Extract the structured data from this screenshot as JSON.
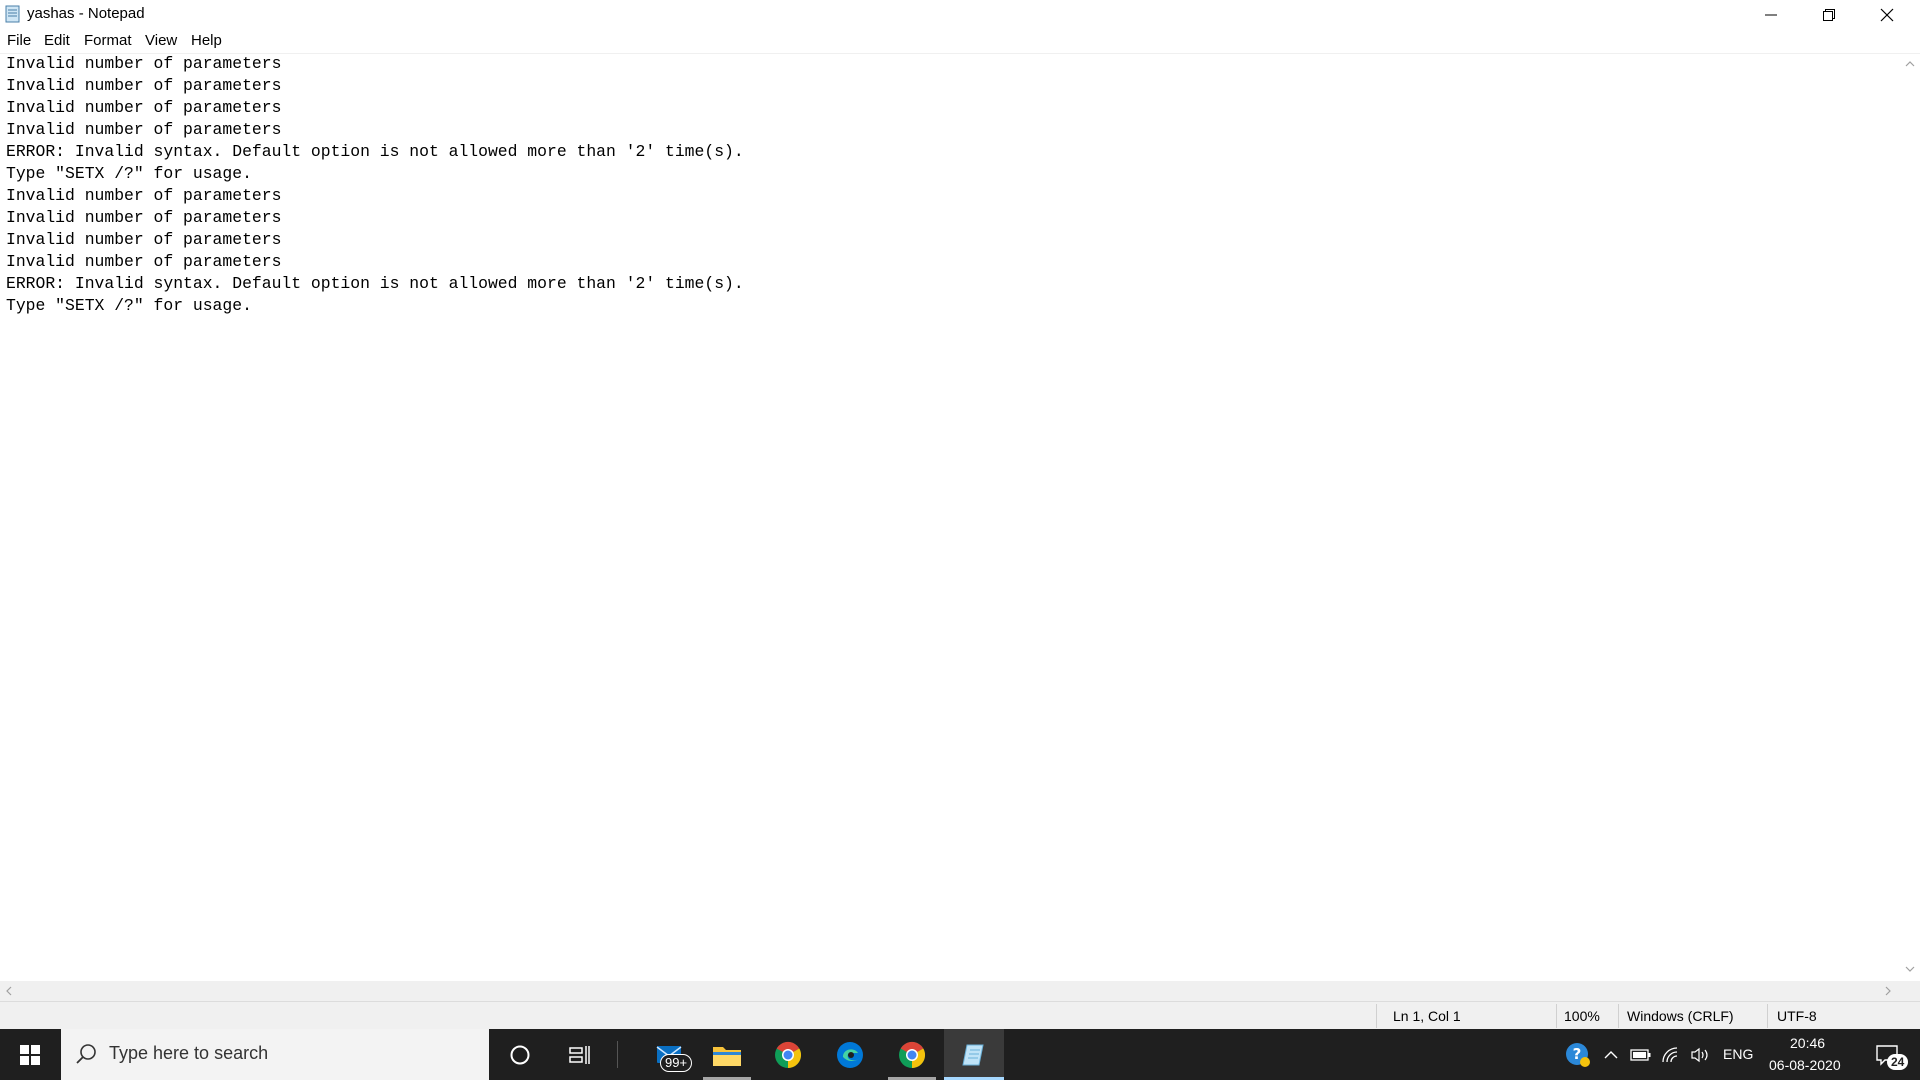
{
  "window": {
    "title": "yashas - Notepad",
    "controls": {
      "minimize": "minimize",
      "maximize": "restore",
      "close": "close"
    }
  },
  "menu": [
    "File",
    "Edit",
    "Format",
    "View",
    "Help"
  ],
  "editor": {
    "lines": [
      "Invalid number of parameters",
      "Invalid number of parameters",
      "Invalid number of parameters",
      "Invalid number of parameters",
      "ERROR: Invalid syntax. Default option is not allowed more than '2' time(s).",
      "Type \"SETX /?\" for usage.",
      "Invalid number of parameters",
      "Invalid number of parameters",
      "Invalid number of parameters",
      "Invalid number of parameters",
      "ERROR: Invalid syntax. Default option is not allowed more than '2' time(s).",
      "Type \"SETX /?\" for usage."
    ]
  },
  "status": {
    "position": "Ln 1, Col 1",
    "zoom": "100%",
    "line_ending": "Windows (CRLF)",
    "encoding": "UTF-8"
  },
  "taskbar": {
    "search_placeholder": "Type here to search",
    "mail_badge": "99+",
    "apps": [
      "windows-start-icon",
      "cortana-icon",
      "task-view-icon",
      "mail-icon",
      "file-explorer-icon",
      "chrome-icon",
      "edge-icon",
      "chrome-icon",
      "notepad-icon"
    ],
    "tray": {
      "language": "ENG",
      "time": "20:46",
      "date": "06-08-2020",
      "notifications": "24"
    }
  },
  "colors": {
    "taskbar": "#1f1f1f",
    "statusbar": "#f0f0f0",
    "chrome_red": "#db4437",
    "chrome_yellow": "#f4c20d",
    "chrome_green": "#0f9d58",
    "edge_blue": "#0078d7",
    "explorer_yellow": "#f8c33a"
  }
}
